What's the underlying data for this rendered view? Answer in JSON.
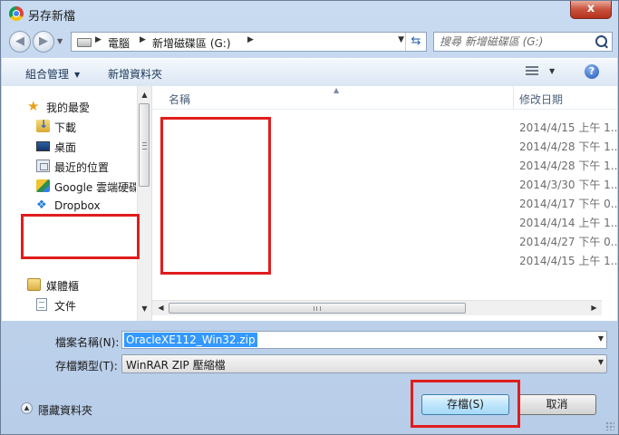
{
  "window": {
    "title": "另存新檔",
    "close_label": "x"
  },
  "navbar": {
    "back_label": "◀",
    "forward_label": "▶",
    "breadcrumb": [
      "電腦",
      "新增磁碟區 (G:)"
    ],
    "search_placeholder": "搜尋 新增磁碟區 (G:)"
  },
  "toolbar": {
    "organize_label": "組合管理",
    "new_folder_label": "新增資料夾",
    "help_label": "?"
  },
  "sidebar": {
    "favorites_label": "我的最愛",
    "items": [
      "下載",
      "桌面",
      "最近的位置",
      "Google 雲端硬碟",
      "Dropbox"
    ],
    "libraries_label": "媒體櫃",
    "library_items": [
      "文件"
    ]
  },
  "filelist": {
    "col_name": "名稱",
    "col_date": "修改日期",
    "dates": [
      "2014/4/15 上午 1...",
      "2014/4/28 下午 1...",
      "2014/4/28 下午 1...",
      "2014/3/30 下午 1...",
      "2014/4/17 下午 0...",
      "2014/4/14 上午 1...",
      "2014/4/27 下午 0...",
      "2014/4/15 上午 1..."
    ]
  },
  "form": {
    "filename_label": "檔案名稱(N):",
    "filename_value": "OracleXE112_Win32.zip",
    "filetype_label": "存檔類型(T):",
    "filetype_value": "WinRAR ZIP 壓縮檔"
  },
  "footer": {
    "hide_folders_label": "隱藏資料夾",
    "save_label": "存檔(S)",
    "cancel_label": "取消"
  }
}
